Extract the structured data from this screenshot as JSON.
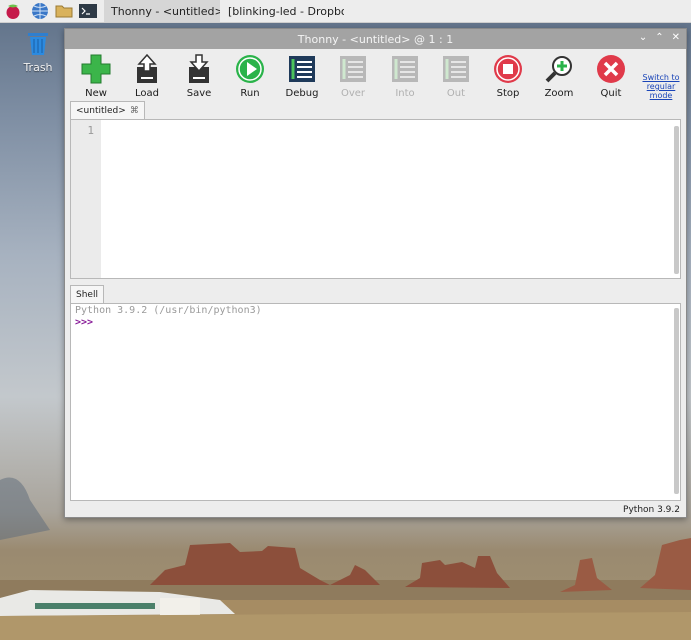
{
  "taskbar": {
    "tasks": [
      {
        "label": "Thonny  -  <untitled>  ..."
      },
      {
        "label": "[blinking-led - Dropbo..."
      }
    ]
  },
  "desktop": {
    "trash_label": "Trash"
  },
  "window": {
    "title": "Thonny  -  <untitled>  @  1 : 1",
    "toolbar": {
      "new": "New",
      "load": "Load",
      "save": "Save",
      "run": "Run",
      "debug": "Debug",
      "over": "Over",
      "into": "Into",
      "out": "Out",
      "stop": "Stop",
      "zoom": "Zoom",
      "quit": "Quit"
    },
    "switch_mode": "Switch to regular mode",
    "editor": {
      "tab_label": "<untitled>",
      "tab_close": "⌘",
      "line_numbers": "1"
    },
    "shell": {
      "tab_label": "Shell",
      "banner": "Python 3.9.2 (/usr/bin/python3)",
      "prompt": ">>>"
    },
    "status": "Python 3.9.2"
  },
  "colors": {
    "run_green": "#2ab34a",
    "stop_red": "#e03a4a",
    "prompt_purple": "#8a1f9a",
    "link_blue": "#1a45b8"
  }
}
